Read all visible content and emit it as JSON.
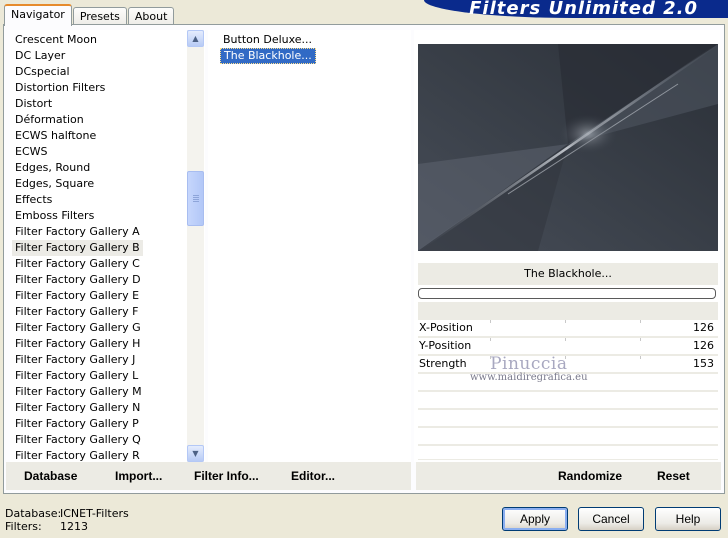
{
  "tabs": [
    {
      "label": "Navigator",
      "active": true
    },
    {
      "label": "Presets",
      "active": false
    },
    {
      "label": "About",
      "active": false
    }
  ],
  "banner_title": "Filters Unlimited 2.0",
  "categories": [
    "Crescent Moon",
    "DC Layer",
    "DCspecial",
    "Distortion Filters",
    "Distort",
    "Déformation",
    "ECWS halftone",
    "ECWS",
    "Edges, Round",
    "Edges, Square",
    "Effects",
    "Emboss Filters",
    "Filter Factory Gallery A",
    "Filter Factory Gallery B",
    "Filter Factory Gallery C",
    "Filter Factory Gallery D",
    "Filter Factory Gallery E",
    "Filter Factory Gallery F",
    "Filter Factory Gallery G",
    "Filter Factory Gallery H",
    "Filter Factory Gallery J",
    "Filter Factory Gallery L",
    "Filter Factory Gallery M",
    "Filter Factory Gallery N",
    "Filter Factory Gallery P",
    "Filter Factory Gallery Q",
    "Filter Factory Gallery R"
  ],
  "selected_category_index": 13,
  "filters": [
    "Button Deluxe...",
    "The Blackhole..."
  ],
  "selected_filter_index": 1,
  "preview": {
    "filter_name": "The Blackhole..."
  },
  "params": [
    {
      "label": "X-Position",
      "value": "126"
    },
    {
      "label": "Y-Position",
      "value": "126"
    },
    {
      "label": "Strength",
      "value": "153"
    }
  ],
  "watermark": {
    "line1": "Pinuccia",
    "line2": "www.maidiregrafica.eu"
  },
  "toolbar": {
    "database": "Database",
    "import": "Import...",
    "filter_info": "Filter Info...",
    "editor": "Editor...",
    "randomize": "Randomize",
    "reset": "Reset"
  },
  "status": {
    "database_label": "Database:",
    "database_value": "ICNET-Filters",
    "filters_label": "Filters:",
    "filters_value": "1213"
  },
  "buttons": {
    "apply": "Apply",
    "cancel": "Cancel",
    "help": "Help"
  },
  "colors": {
    "selection": "#316ac5",
    "banner": "#0a2a8c",
    "tab_accent": "#e68b2c"
  }
}
